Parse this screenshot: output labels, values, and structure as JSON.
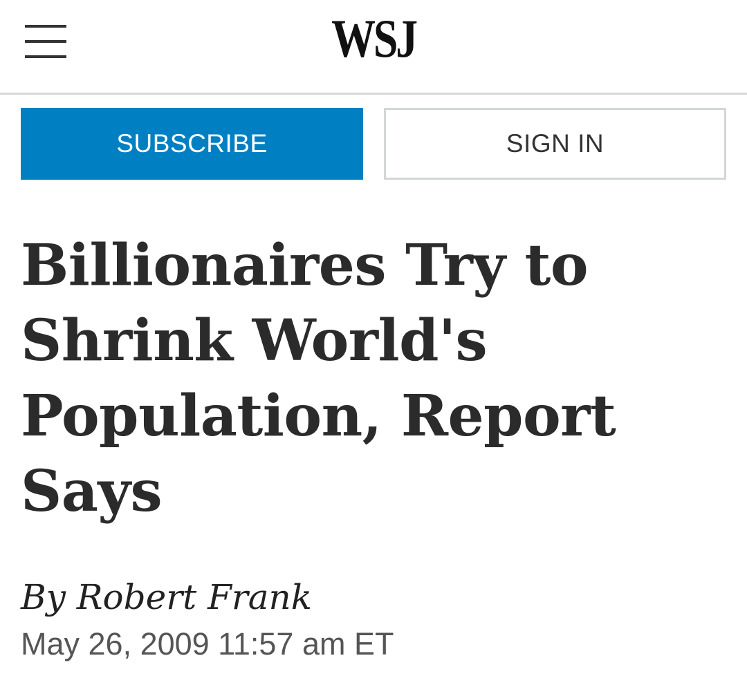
{
  "header": {
    "menu_icon": "hamburger-menu-icon",
    "logo_text": "WSJ"
  },
  "actions": {
    "subscribe_label": "SUBSCRIBE",
    "signin_label": "SIGN IN",
    "subscribe_color": "#0080c3"
  },
  "article": {
    "headline": "Billionaires Try to Shrink World's Population, Report Says",
    "byline_prefix": "By",
    "author": "Robert Frank",
    "timestamp": "May 26, 2009 11:57 am ET"
  }
}
